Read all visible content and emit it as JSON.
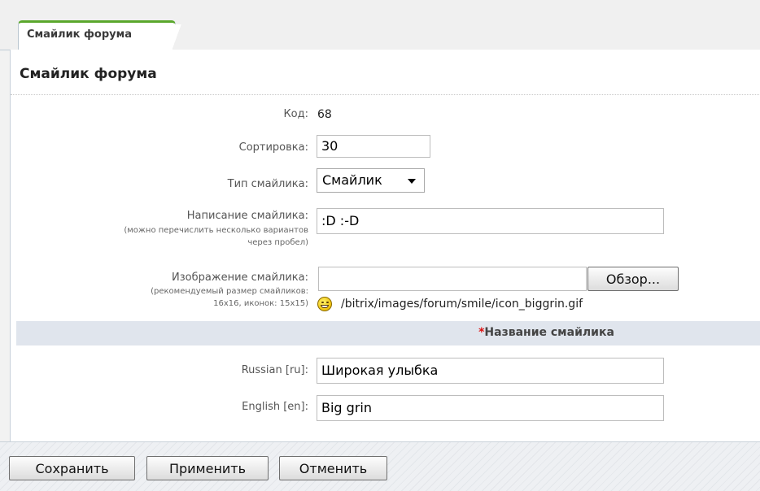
{
  "tab": {
    "label": "Смайлик форума"
  },
  "panel": {
    "title": "Смайлик форума"
  },
  "form": {
    "code": {
      "label": "Код:",
      "value": "68"
    },
    "sort": {
      "label": "Сортировка:",
      "value": "30"
    },
    "type": {
      "label": "Тип смайлика:",
      "value": "Смайлик"
    },
    "typing": {
      "label": "Написание смайлика:",
      "hint_line1": "(можно перечислить несколько вариантов",
      "hint_line2": "через пробел)",
      "value": ":D :-D"
    },
    "image": {
      "label": "Изображение смайлика:",
      "hint_line1": "(рекомендуемый размер смайликов:",
      "hint_line2": "16x16, иконок: 15x15)",
      "value": "",
      "browse_label": "Обзор...",
      "icon": "biggrin-smiley-icon",
      "path": "/bitrix/images/forum/smile/icon_biggrin.gif"
    },
    "name_section": {
      "required_mark": "*",
      "title": "Название смайлика"
    },
    "name_ru": {
      "label": "Russian [ru]:",
      "value": "Широкая улыбка"
    },
    "name_en": {
      "label": "English [en]:",
      "value": "Big grin"
    }
  },
  "buttons": {
    "save": "Сохранить",
    "apply": "Применить",
    "cancel": "Отменить"
  },
  "colors": {
    "tab_accent": "#5aa72c",
    "section_header_bg": "#e0e5ed",
    "required": "#dd1111"
  }
}
